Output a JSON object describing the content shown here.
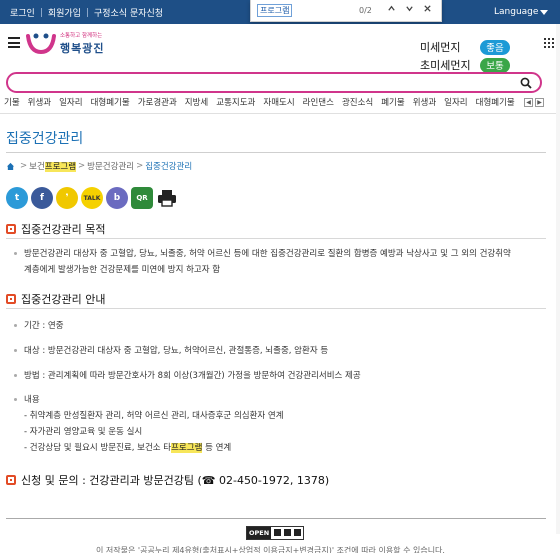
{
  "topbar": {
    "links": [
      "로그인",
      "회원가입",
      "구정소식 문자신청"
    ],
    "language": "Language"
  },
  "findbar": {
    "query": "프로그램",
    "count": "0/2"
  },
  "header": {
    "brand": "행복광진",
    "slogan": "소통하고 함께하는",
    "air": [
      {
        "label": "미세먼지",
        "status": "좋음",
        "color": "#1d9ad6"
      },
      {
        "label": "초미세먼지",
        "status": "보통",
        "color": "#3aa648"
      }
    ]
  },
  "search": {
    "placeholder": ""
  },
  "tags": [
    "기물",
    "위생과",
    "일자리",
    "대형폐기물",
    "가로경관과",
    "지방세",
    "교통지도과",
    "자매도시",
    "라인댄스",
    "광진소식",
    "폐기물",
    "위생과",
    "일자리",
    "대형폐기물"
  ],
  "page": {
    "title": "집중건강관리",
    "breadcrumb": {
      "part1": "보건",
      "part1_hl": "프로그램",
      "part2": "방문건강관리",
      "current": "집중건강관리"
    },
    "share": [
      {
        "name": "twitter",
        "glyph": "t",
        "color": "#2c9ad8"
      },
      {
        "name": "facebook",
        "glyph": "f",
        "color": "#3b5a9a"
      },
      {
        "name": "kakaostory",
        "glyph": "❜",
        "color": "#f0c800"
      },
      {
        "name": "kakaotalk",
        "glyph": "TALK",
        "color": "#f5d100"
      },
      {
        "name": "band",
        "glyph": "b",
        "color": "#6b6bc0"
      },
      {
        "name": "qr",
        "glyph": "QR",
        "color": "#2f8a3a"
      },
      {
        "name": "print",
        "glyph": "",
        "color": "#222222"
      }
    ],
    "sections": [
      {
        "title": "집중건강관리 목적",
        "lines": [
          "방문건강관리 대상자 중 고혈압, 당뇨, 뇌졸중, 허약 어르신 등에 대한 집중건강관리로 질환의 합병증 예방과 낙상사고 및 그 외의 건강취약",
          "계층에게 발생가능한 건강문제를 미연에 방지 하고자 함"
        ]
      },
      {
        "title": "집중건강관리 안내",
        "items": [
          "기간 : 연중",
          "대상 : 방문건강관리 대상자 중 고혈압, 당뇨, 허약어르신, 관절통증, 뇌졸중, 암환자 등",
          "방법 : 관리계획에 따라 방문간호사가 8회 이상(3개월간) 가정을 방문하여 건강관리서비스 제공",
          "내용"
        ],
        "subitems": [
          "- 취약계층 만성질환자 관리, 허약 어르신 관리, 대사증후군 의심환자 연계",
          "- 자가관리 영양교육 및 운동 실시"
        ],
        "last_pre": "- 건강상담 및 필요시 방문진료, 보건소 타",
        "last_hl": "프로그램",
        "last_post": " 등 연계"
      },
      {
        "title": "신청 및 문의 : 건강관리과 방문건강팀 (☎ 02-450-1972, 1378)"
      }
    ]
  },
  "footer": {
    "open": "OPEN",
    "text": "이 저작물은 '공공누리 제4유형(출처표시+상업적 이용금지+변경금지)' 조건에 따라 이용할 수 있습니다."
  }
}
